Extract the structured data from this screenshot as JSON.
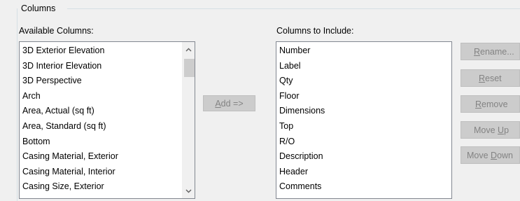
{
  "group": {
    "title": "Columns"
  },
  "available": {
    "label": "Available Columns:",
    "items": [
      "3D Exterior Elevation",
      "3D Interior Elevation",
      "3D Perspective",
      "Arch",
      "Area, Actual (sq ft)",
      "Area, Standard (sq ft)",
      "Bottom",
      "Casing Material, Exterior",
      "Casing Material, Interior",
      "Casing Size, Exterior"
    ]
  },
  "include": {
    "label": "Columns to Include:",
    "items": [
      "Number",
      "Label",
      "Qty",
      "Floor",
      "Dimensions",
      "Top",
      "R/O",
      "Description",
      "Header",
      "Comments"
    ]
  },
  "buttons": {
    "add": {
      "mnemonic": "A",
      "rest": "dd =>"
    },
    "rename": {
      "mnemonic": "R",
      "rest": "ename..."
    },
    "reset": {
      "mnemonic": "R",
      "rest": "eset"
    },
    "remove": {
      "mnemonic": "R",
      "rest": "emove"
    },
    "move_up": {
      "before": "Move ",
      "mnemonic": "U",
      "rest": "p"
    },
    "move_down": {
      "before": "Move ",
      "mnemonic": "D",
      "rest": "own"
    }
  },
  "icons": {
    "scroll_up": "chevron-up-icon",
    "scroll_down": "chevron-down-icon"
  },
  "colors": {
    "disabled_button_bg": "#cccccc",
    "disabled_button_text": "#838383",
    "scroll_thumb": "#cdcdcd"
  }
}
